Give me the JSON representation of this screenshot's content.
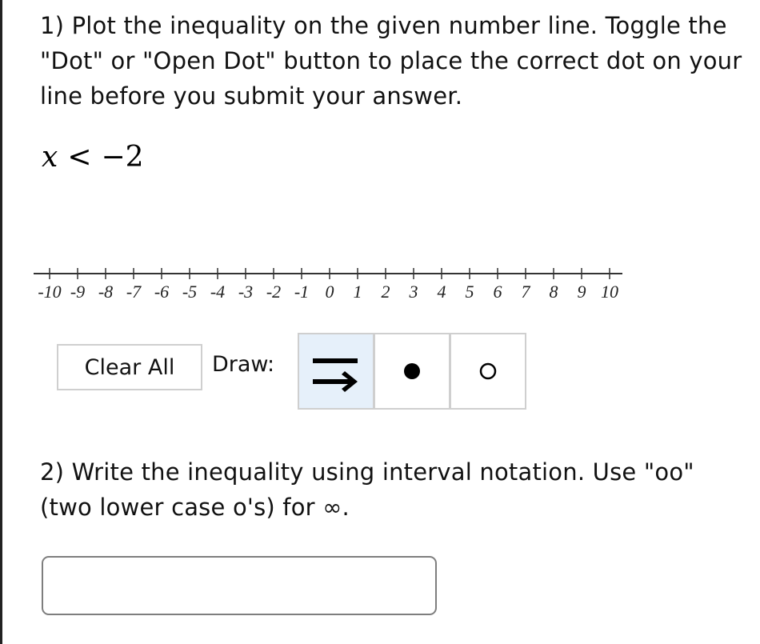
{
  "question1": {
    "text": "1) Plot the inequality on the given number line. Toggle the \"Dot\" or \"Open Dot\" button to place the correct dot on your line before you submit your answer.",
    "inequality": {
      "variable": "x",
      "operator": "<",
      "value": "−2"
    }
  },
  "number_line": {
    "min": -10,
    "max": 10,
    "step": 1,
    "tick_labels": [
      "-10",
      "-9",
      "-8",
      "-7",
      "-6",
      "-5",
      "-4",
      "-3",
      "-2",
      "-1",
      "0",
      "1",
      "2",
      "3",
      "4",
      "5",
      "6",
      "7",
      "8",
      "9",
      "10"
    ]
  },
  "toolbar": {
    "clear_all_label": "Clear All",
    "draw_label": "Draw:",
    "tools": [
      {
        "name": "line-ray",
        "icon": "line-ray-icon",
        "selected": true
      },
      {
        "name": "dot",
        "icon": "closed-dot-icon",
        "selected": false
      },
      {
        "name": "open-dot",
        "icon": "open-dot-icon",
        "selected": false
      }
    ],
    "selected_color": "#e6f0fa"
  },
  "question2": {
    "text": "2) Write the inequality using interval notation. Use \"oo\" (two lower case o's) for ∞.",
    "answer_value": "",
    "answer_placeholder": ""
  }
}
